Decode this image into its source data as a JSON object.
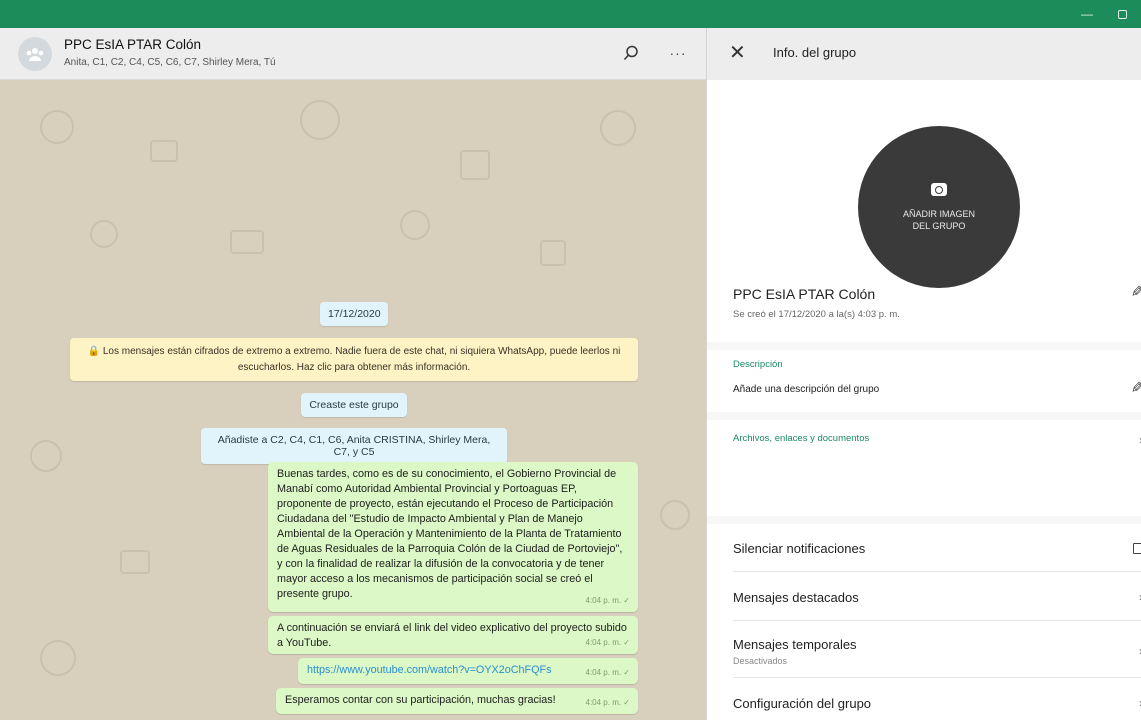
{
  "window": {
    "minimize_icon": "minimize-icon",
    "maximize_icon": "maximize-icon"
  },
  "chat": {
    "title": "PPC EsIA PTAR Colón",
    "participants": "Anita, C1, C2, C4, C5, C6, C7, Shirley Mera, Tú",
    "menu_label": "···",
    "date_chip": "17/12/2020",
    "encryption_notice": "🔒 Los mensajes están cifrados de extremo a extremo. Nadie fuera de este chat, ni siquiera WhatsApp, puede leerlos ni escucharlos. Haz clic para obtener más información.",
    "system_messages": [
      "Creaste este grupo",
      "Añadiste a C2, C4, C1, C6, Anita CRISTINA, Shirley Mera, C7, y C5"
    ],
    "messages": [
      {
        "text": "Buenas tardes, como es de su conocimiento, el Gobierno Provincial de Manabí como Autoridad Ambiental Provincial y Portoaguas EP, proponente de proyecto, están ejecutando el Proceso de Participación Ciudadana del \"Estudio de Impacto Ambiental y Plan de Manejo Ambiental de la Operación y Mantenimiento de la Planta de Tratamiento de Aguas Residuales de la Parroquia Colón de la Ciudad de Portoviejo\", y con la finalidad de realizar la difusión de la convocatoria y de tener mayor acceso a los mecanismos de participación social se creó el presente grupo.",
        "time": "4:04 p. m. ✓"
      },
      {
        "text": "A continuación se enviará el link del video explicativo del proyecto subido a YouTube.",
        "time": "4:04 p. m. ✓"
      },
      {
        "text": "https://www.youtube.com/watch?v=OYX2oChFQFs",
        "time": "4:04 p. m. ✓"
      },
      {
        "text": "Esperamos contar con su participación, muchas gracias!",
        "time": "4:04 p. m. ✓"
      }
    ]
  },
  "info": {
    "header_title": "Info. del grupo",
    "add_image_label": "AÑADIR IMAGEN DEL GRUPO",
    "group_name": "PPC EsIA PTAR Colón",
    "created": "Se creó el 17/12/2020 a la(s) 4:03 p. m.",
    "description_label": "Descripción",
    "description_placeholder": "Añade una descripción del grupo",
    "files_label": "Archivos, enlaces y documentos",
    "mute_label": "Silenciar notificaciones",
    "starred_label": "Mensajes destacados",
    "temporal_label": "Mensajes temporales",
    "temporal_status": "Desactivados",
    "settings_label": "Configuración del grupo"
  },
  "colors": {
    "titlebar": "#1b8c5a",
    "outgoing_bubble": "#dcf8c6",
    "accent": "#1a8a66",
    "chat_bg": "#d9cfbd"
  }
}
